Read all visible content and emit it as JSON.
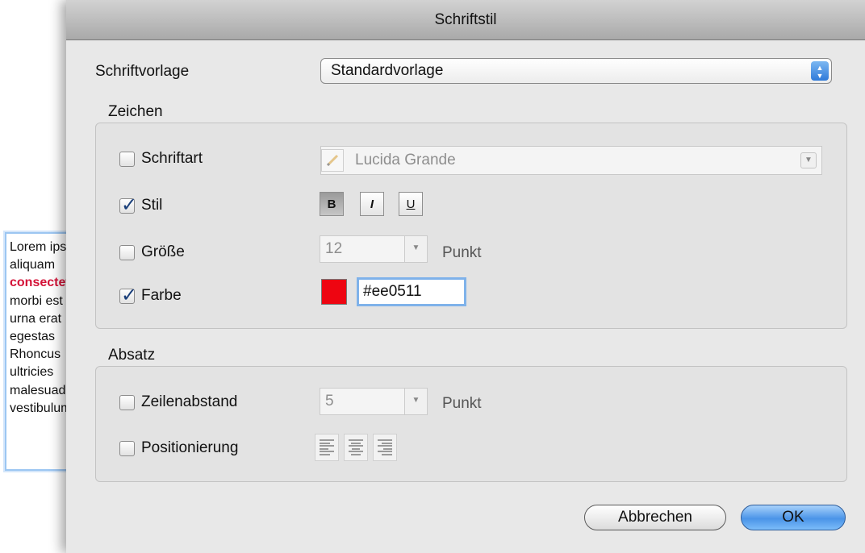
{
  "background_text": {
    "lines": [
      {
        "text": "Lorem ipsum",
        "style": "normal"
      },
      {
        "text": "aliquam",
        "style": "normal"
      },
      {
        "text": "consectetur",
        "style": "red"
      },
      {
        "text": "morbi est",
        "style": "normal"
      },
      {
        "text": "urna erat",
        "style": "normal"
      },
      {
        "text": "egestas",
        "style": "normal"
      },
      {
        "text": "Rhoncus",
        "style": "normal"
      },
      {
        "text": "ultricies",
        "style": "normal"
      },
      {
        "text": "malesuada",
        "style": "normal"
      },
      {
        "text": "vestibulum",
        "style": "normal"
      }
    ],
    "highlight_color": "#d41338"
  },
  "dialog": {
    "title": "Schriftstil",
    "template_label": "Schriftvorlage",
    "template_value": "Standardvorlage",
    "zeichen": {
      "title": "Zeichen",
      "schriftart": {
        "label": "Schriftart",
        "checked": false,
        "value": "Lucida Grande"
      },
      "stil": {
        "label": "Stil",
        "checked": true,
        "bold": "B",
        "italic": "I",
        "underline": "U",
        "bold_active": true
      },
      "groesse": {
        "label": "Größe",
        "checked": false,
        "value": "12",
        "unit": "Punkt"
      },
      "farbe": {
        "label": "Farbe",
        "checked": true,
        "value": "#ee0511",
        "swatch": "#ee0511"
      }
    },
    "absatz": {
      "title": "Absatz",
      "zeilenabstand": {
        "label": "Zeilenabstand",
        "checked": false,
        "value": "5",
        "unit": "Punkt"
      },
      "positionierung": {
        "label": "Positionierung",
        "checked": false,
        "options": [
          "align-left",
          "align-center",
          "align-right"
        ]
      }
    },
    "buttons": {
      "cancel": "Abbrechen",
      "ok": "OK"
    },
    "colors": {
      "background": "#e8e8e8",
      "accent": "#4a94e8"
    }
  }
}
